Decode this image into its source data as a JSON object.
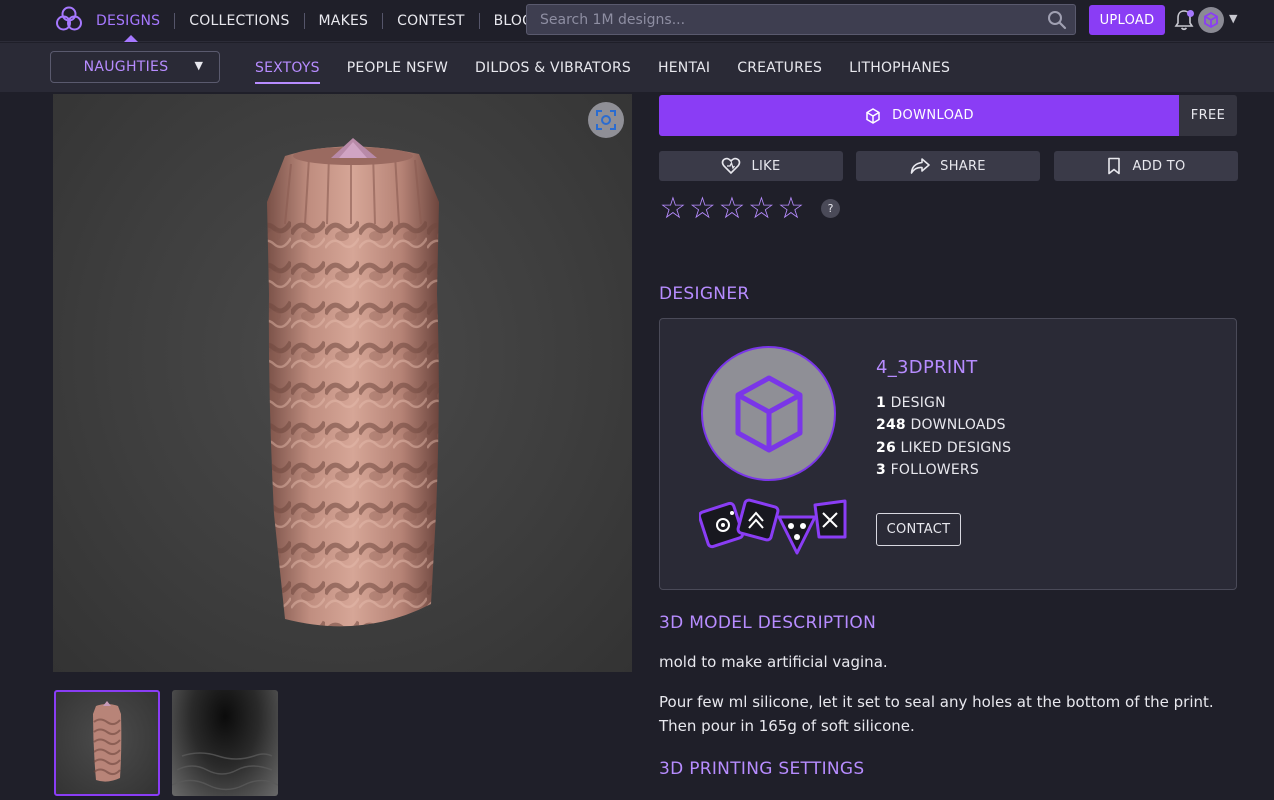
{
  "nav": {
    "items": [
      {
        "label": "DESIGNS",
        "active": true
      },
      {
        "label": "COLLECTIONS",
        "active": false
      },
      {
        "label": "MAKES",
        "active": false
      },
      {
        "label": "CONTEST",
        "active": false
      },
      {
        "label": "BLOG",
        "active": false
      }
    ],
    "search_placeholder": "Search 1M designs...",
    "upload_label": "UPLOAD",
    "icons": [
      "logo-icon",
      "search-icon",
      "bell-icon",
      "user-avatar",
      "chevron-down-icon"
    ]
  },
  "subnav": {
    "category_select": "NAUGHTIES",
    "items": [
      {
        "label": "SEXTOYS",
        "active": true
      },
      {
        "label": "PEOPLE NSFW",
        "active": false
      },
      {
        "label": "DILDOS & VIBRATORS",
        "active": false
      },
      {
        "label": "HENTAI",
        "active": false
      },
      {
        "label": "CREATURES",
        "active": false
      },
      {
        "label": "LITHOPHANES",
        "active": false
      }
    ]
  },
  "actions": {
    "download_label": "DOWNLOAD",
    "price_label": "FREE",
    "like_label": "LIKE",
    "share_label": "SHARE",
    "add_to_label": "ADD TO",
    "rating_stars": 5,
    "rating_value": 0,
    "help_label": "?"
  },
  "designer": {
    "section_title": "DESIGNER",
    "name": "4_3DPRINT",
    "stats": [
      {
        "value": "1",
        "label": "DESIGN"
      },
      {
        "value": "248",
        "label": "DOWNLOADS"
      },
      {
        "value": "26",
        "label": "LIKED DESIGNS"
      },
      {
        "value": "3",
        "label": "FOLLOWERS"
      }
    ],
    "contact_label": "CONTACT"
  },
  "description": {
    "section_title": "3D MODEL DESCRIPTION",
    "paragraphs": [
      "mold to make artificial vagina.",
      "Pour few ml silicone, let it set to seal any holes at the bottom of the print. Then pour in 165g of soft silicone."
    ]
  },
  "printing": {
    "section_title": "3D PRINTING SETTINGS"
  },
  "colors": {
    "accent": "#8a3df5",
    "accent_text": "#b78cff",
    "background": "#1f1f29",
    "panel": "#2a2a36"
  }
}
